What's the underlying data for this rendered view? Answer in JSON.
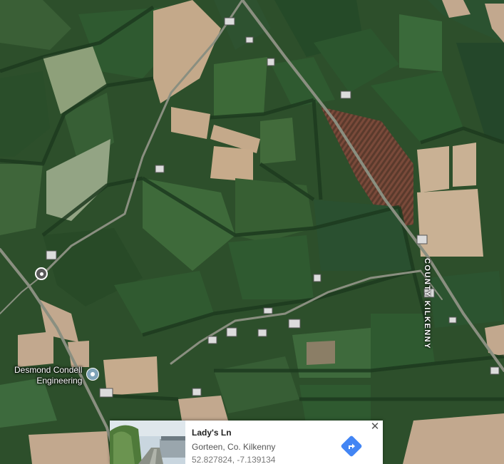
{
  "map": {
    "type": "satellite",
    "road_label": "COUNTY KILKENNY",
    "poi": {
      "name_line1": "Desmond Condell",
      "name_line2": "Engineering",
      "icon": "poi-pin-icon"
    },
    "selected_marker_icon": "location-pin-icon"
  },
  "place_card": {
    "title": "Lady's Ln",
    "subtitle": "Gorteen, Co. Kilkenny",
    "coordinates": "52.827824, -7.139134",
    "directions_icon": "directions-icon",
    "close_label": "✕",
    "accent": "#4285f4"
  }
}
